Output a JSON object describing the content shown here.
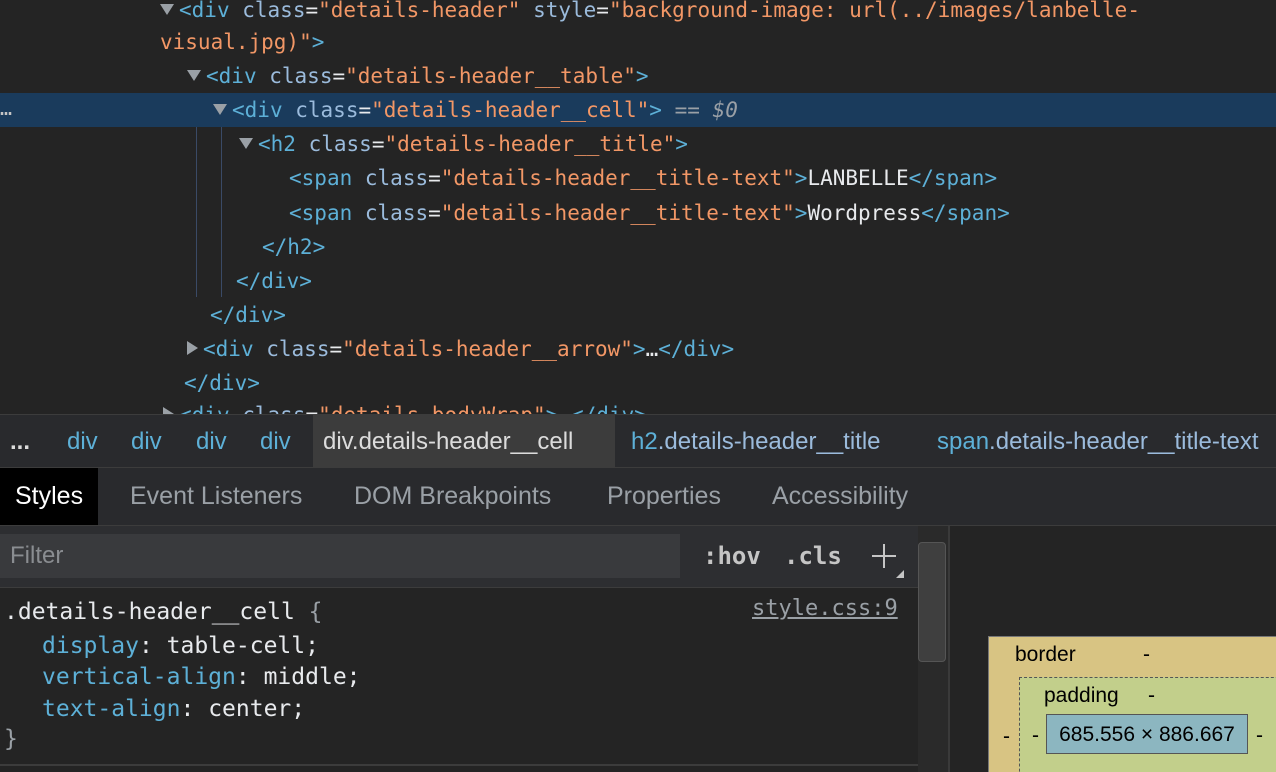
{
  "dom_tree": {
    "lines": [
      {
        "open": "<",
        "tag": "div",
        "attr": "class",
        "eq": "=",
        "val": "\"details-header\"",
        "attr2": "style",
        "eq2": "=",
        "val2": "\"background-image: url(../images/lanbelle-"
      },
      {
        "cont": "visual.jpg)\"",
        "close": ">"
      },
      {
        "open": "<",
        "tag": "div",
        "attr": "class",
        "eq": "=",
        "val": "\"details-header__table\"",
        "close": ">"
      },
      {
        "open": "<",
        "tag": "div",
        "attr": "class",
        "eq": "=",
        "val": "\"details-header__cell\"",
        "close": ">",
        "marker": "==",
        "var": "$0"
      },
      {
        "open": "<",
        "tag": "h2",
        "attr": "class",
        "eq": "=",
        "val": "\"details-header__title\"",
        "close": ">"
      },
      {
        "open": "<",
        "tag": "span",
        "attr": "class",
        "eq": "=",
        "val": "\"details-header__title-text\"",
        "close": ">",
        "text": "LANBELLE",
        "end": "</span>"
      },
      {
        "open": "<",
        "tag": "span",
        "attr": "class",
        "eq": "=",
        "val": "\"details-header__title-text\"",
        "close": ">",
        "text": "Wordpress",
        "end": "</span>"
      },
      {
        "end": "</h2>"
      },
      {
        "end": "</div>"
      },
      {
        "end": "</div>"
      },
      {
        "open": "<",
        "tag": "div",
        "attr": "class",
        "eq": "=",
        "val": "\"details-header__arrow\"",
        "close": ">",
        "ellipsis": "…",
        "end": "</div>"
      },
      {
        "end": "</div>"
      },
      {
        "open": "<",
        "tag": "div",
        "attr": "class",
        "eq": "=",
        "val": "\"details-bodyWrap\"",
        "close": ">",
        "ellipsis": "…",
        "end": "</div>"
      }
    ],
    "gutter_dots": "…"
  },
  "breadcrumb": {
    "more": "...",
    "items": [
      {
        "tag": "div",
        "cls": ""
      },
      {
        "tag": "div",
        "cls": ""
      },
      {
        "tag": "div",
        "cls": ""
      },
      {
        "tag": "div",
        "cls": ""
      },
      {
        "tag": "div",
        "cls": ".details-header__cell"
      },
      {
        "tag": "h2",
        "cls": ".details-header__title"
      },
      {
        "tag": "span",
        "cls": ".details-header__title-text"
      }
    ]
  },
  "tabs": [
    "Styles",
    "Event Listeners",
    "DOM Breakpoints",
    "Properties",
    "Accessibility"
  ],
  "styles": {
    "filter_placeholder": "Filter",
    "filter_value": "",
    "hov": ":hov",
    "cls": ".cls",
    "rule": {
      "selector": ".details-header__cell",
      "open_brace": "{",
      "close_brace": "}",
      "source": "style.css:9",
      "props": [
        {
          "name": "display",
          "value": "table-cell"
        },
        {
          "name": "vertical-align",
          "value": "middle"
        },
        {
          "name": "text-align",
          "value": "center"
        }
      ]
    }
  },
  "box_model": {
    "border_label": "border",
    "border_value": "-",
    "padding_label": "padding",
    "padding_value": "-",
    "content_size": "685.556 × 886.667",
    "left_border": "-",
    "left_padding": "-",
    "right_padding": "-"
  },
  "colors": {
    "selected_row": "#1a3b5c",
    "tag": "#5db0d7",
    "attr_value": "#f29766",
    "border_box": "#d8c483",
    "padding_box": "#c2cf8b",
    "content_box": "#8cb6c0"
  }
}
